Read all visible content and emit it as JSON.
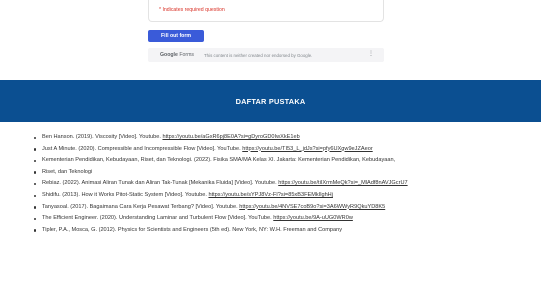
{
  "form": {
    "required_note": "* Indicates required question",
    "fill_button": "Fill out form",
    "footer_logo_google": "Google",
    "footer_logo_forms": "Forms",
    "footer_note": "This content is neither created nor endorsed by Google.",
    "menu_glyph": "⋮"
  },
  "banner": {
    "title": "DAFTAR PUSTAKA"
  },
  "references": [
    {
      "text": "Ben Hanson. (2019). Viscosity [Video]. Youtube. ",
      "link": "https://youtu.be/aGxR6pj8E0A?si=gDyroGD0IwXkE1eb"
    },
    {
      "text": "Just A Minute. (2020). Compressible and Incompressible Flow [Video]. YouTube. ",
      "link": "https://youtu.be/TI53_L_jdJs?si=pfy6UXgw9eJZAeor"
    },
    {
      "text": "Kementerian Pendidikan, Kebudayaan, Riset, dan Teknologi. (2022). Fisika SMA/MA Kelas XI. Jakarta: Kementerian Pendidikan, Kebudayaan,",
      "link": ""
    },
    {
      "text": "Riset, dan Teknologi",
      "link": ""
    },
    {
      "text": "Rebiaz. (2022). Animasi Aliran Tunak dan Aliran Tak-Tunak [Mekanika Fluida] [Video]. Youtube. ",
      "link": "https://youtu.be/tiIXrmMeQk?si=_MlAdf8nAVJGcrU7"
    },
    {
      "text": "Shidifu. (2013). How it Works Pitot-Static System [Video]. Youtube. ",
      "link": "https://youtu.be/sYPJ8Vz-FI?si=85xB3FEMkIlghHj"
    },
    {
      "text": "Tanyasoal. (2017). Bagaimana Cara Kerja Pesawat Terbang? [Video]. Youtube. ",
      "link": "https://youtu.be/4NVSE7coB9o?si=3A6WWyR9QkuYD8K5"
    },
    {
      "text": "The Efficient Engineer. (2020). Understanding Laminar and Turbulent Flow [Video]. YouTube. ",
      "link": "https://youtu.be/9A-uUG0WR0w"
    },
    {
      "text": "Tipler, P.A., Mosca, G. (2012). Physics for Scientists and Engineers (5th ed). New York, NY: W.H. Freeman and Company",
      "link": ""
    }
  ]
}
